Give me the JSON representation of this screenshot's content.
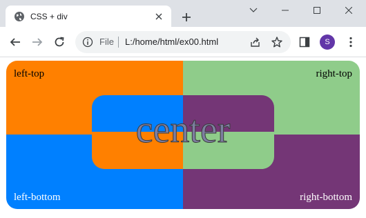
{
  "browser": {
    "tab": {
      "title": "CSS + div",
      "favicon": "globe-icon"
    },
    "window_controls": [
      "chevron-down-icon",
      "minimize-icon",
      "maximize-icon",
      "close-icon"
    ],
    "omnibox": {
      "scheme_label": "File",
      "url": "L:/home/html/ex00.html"
    },
    "profile": {
      "initial": "S",
      "color": "#6236a8"
    }
  },
  "page": {
    "corners": {
      "left_top": "left-top",
      "right_top": "right-top",
      "left_bottom": "left-bottom",
      "right_bottom": "right-bottom"
    },
    "center_text": "center",
    "colors": {
      "orange": "#ff8000",
      "green": "#8fcc8a",
      "blue": "#0080ff",
      "purple": "#743676"
    }
  }
}
